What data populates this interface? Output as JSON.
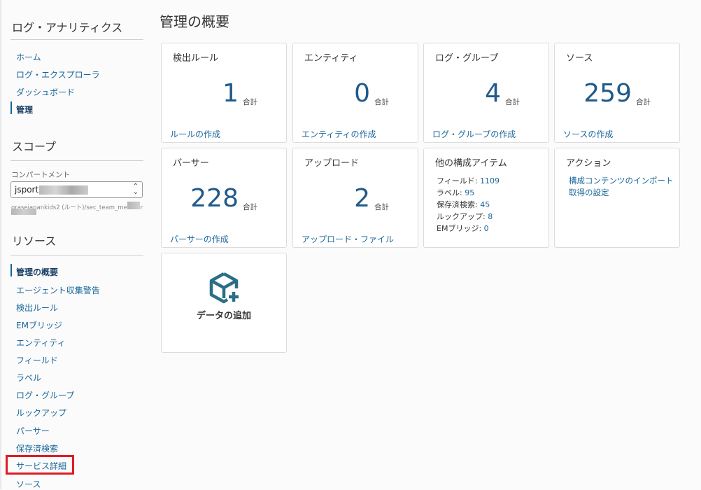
{
  "sidebar": {
    "title": "ログ・アナリティクス",
    "nav": [
      {
        "label": "ホーム"
      },
      {
        "label": "ログ・エクスプローラ"
      },
      {
        "label": "ダッシュボード"
      },
      {
        "label": "管理"
      }
    ],
    "scope_title": "スコープ",
    "compartment_label": "コンパートメント",
    "compartment_value": "jsport.liang",
    "compartment_path": "orasejapankids2 (ルート)/sec_team_member",
    "resources_title": "リソース",
    "resources": [
      {
        "label": "管理の概要"
      },
      {
        "label": "エージェント収集警告"
      },
      {
        "label": "検出ルール"
      },
      {
        "label": "EMブリッジ"
      },
      {
        "label": "エンティティ"
      },
      {
        "label": "フィールド"
      },
      {
        "label": "ラベル"
      },
      {
        "label": "ログ・グループ"
      },
      {
        "label": "ルックアップ"
      },
      {
        "label": "パーサー"
      },
      {
        "label": "保存済検索"
      },
      {
        "label": "サービス詳細"
      },
      {
        "label": "ソース"
      }
    ]
  },
  "main": {
    "title": "管理の概要",
    "cards": [
      {
        "title": "検出ルール",
        "count": "1",
        "unit": "合計",
        "link": "ルールの作成"
      },
      {
        "title": "エンティティ",
        "count": "0",
        "unit": "合計",
        "link": "エンティティの作成"
      },
      {
        "title": "ログ・グループ",
        "count": "4",
        "unit": "合計",
        "link": "ログ・グループの作成"
      },
      {
        "title": "ソース",
        "count": "259",
        "unit": "合計",
        "link": "ソースの作成"
      },
      {
        "title": "パーサー",
        "count": "228",
        "unit": "合計",
        "link": "パーサーの作成"
      },
      {
        "title": "アップロード",
        "count": "2",
        "unit": "合計",
        "link": "アップロード・ファイル"
      }
    ],
    "other_items": {
      "title": "他の構成アイテム",
      "items": [
        {
          "label": "フィールド:",
          "value": "1109"
        },
        {
          "label": "ラベル:",
          "value": "95"
        },
        {
          "label": "保存済検索:",
          "value": "45"
        },
        {
          "label": "ルックアップ:",
          "value": "8"
        },
        {
          "label": "EMブリッジ:",
          "value": "0"
        }
      ]
    },
    "actions": {
      "title": "アクション",
      "links": [
        {
          "label": "構成コンテンツのインポート"
        },
        {
          "label": "取得の設定"
        }
      ]
    },
    "add_data": {
      "label": "データの追加",
      "icon": "cube-plus-icon"
    }
  },
  "colors": {
    "link": "#1a6699",
    "count": "#1f5a8a",
    "highlight": "#e01b24"
  }
}
